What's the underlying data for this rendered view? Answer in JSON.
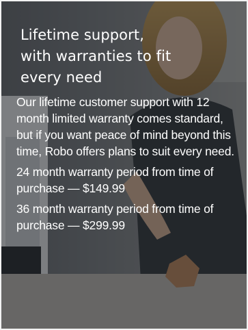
{
  "card": {
    "heading_line1": "Lifetime support,",
    "heading_line2": "with warranties to fit",
    "heading_line3": "every need",
    "body": "Our lifetime customer support with 12 month limited warranty comes standard, but if you want peace of mind beyond this time, Robo offers plans to suit every need.",
    "plans": [
      {
        "text": "24 month warranty period from time of purchase — $149.99"
      },
      {
        "text": "36 month warranty period from time of purchase — $299.99"
      }
    ]
  },
  "colors": {
    "text": "#ffffff",
    "overlay": "rgba(28,30,34,0.52)",
    "frame": "#f2f2f2"
  },
  "image": {
    "icon": "photo-woman-with-3d-printer"
  }
}
